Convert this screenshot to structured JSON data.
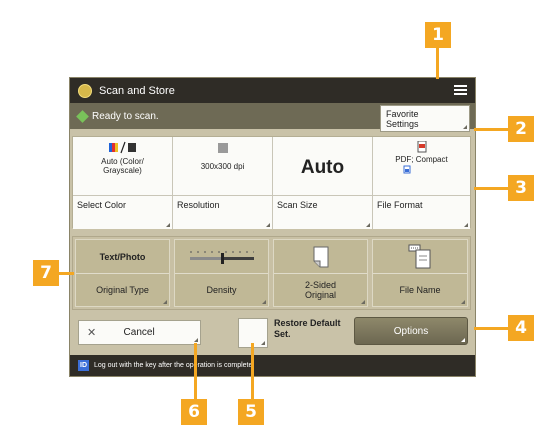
{
  "window": {
    "title": "Scan and Store"
  },
  "status": {
    "text": "Ready to scan."
  },
  "favorite_button": {
    "line1": "Favorite",
    "line2": "Settings"
  },
  "settings": [
    {
      "value": "Auto (Color/ Grayscale)",
      "label": "Select Color",
      "icon": "color-mode-icon"
    },
    {
      "value": "300x300 dpi",
      "label": "Resolution",
      "icon": "resolution-icon"
    },
    {
      "value": "Auto",
      "label": "Scan Size",
      "icon": ""
    },
    {
      "value": "PDF; Compact",
      "label": "File Format",
      "icon": "pdf-file-icon"
    }
  ],
  "functions": [
    {
      "top": "Text/Photo",
      "bottom": "Original Type"
    },
    {
      "top": "",
      "bottom": "Density",
      "icon": "density-slider-icon"
    },
    {
      "top": "",
      "bottom": "2-Sided Original",
      "icon": "two-sided-page-icon"
    },
    {
      "top": "",
      "bottom": "File Name",
      "icon": "file-name-icon"
    }
  ],
  "cancel_button": {
    "label": "Cancel"
  },
  "restore_default": {
    "label": "Restore Default Set."
  },
  "options_button": {
    "label": "Options"
  },
  "footer": {
    "badge": "ID",
    "text": "Log out with the  key after the operation is complete."
  },
  "callouts": [
    "1",
    "2",
    "3",
    "4",
    "5",
    "6",
    "7"
  ],
  "colors": {
    "callout": "#f4a722",
    "titlebar": "#2f2c26",
    "panel": "#c9c2a8",
    "options": "#6c6751"
  }
}
